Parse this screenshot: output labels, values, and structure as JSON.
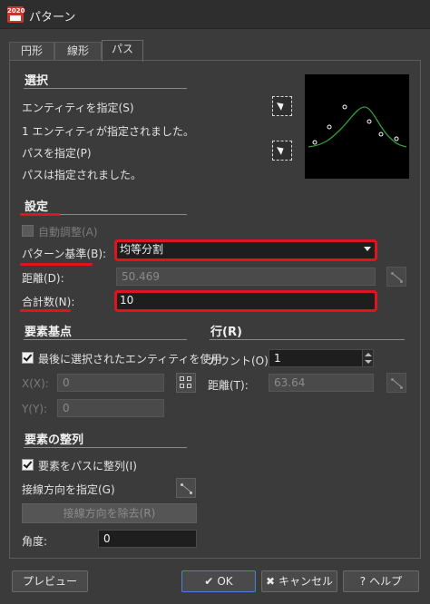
{
  "window": {
    "title": "パターン",
    "logo_text": "2020"
  },
  "tabs": [
    {
      "label": "円形",
      "active": false
    },
    {
      "label": "線形",
      "active": false
    },
    {
      "label": "パス",
      "active": true
    }
  ],
  "selection": {
    "heading": "選択",
    "entity_label": "エンティティを指定(S)",
    "entity_status": "1 エンティティが指定されました。",
    "path_label": "パスを指定(P)",
    "path_status": "パスは指定されました。"
  },
  "settings": {
    "heading": "設定",
    "auto_adjust_label": "自動調整(A)",
    "pattern_basis_label": "パターン基準(B):",
    "pattern_basis_value": "均等分割",
    "distance_label": "距離(D):",
    "distance_value": "50.469",
    "total_label": "合計数(N):",
    "total_value": "10"
  },
  "base_point": {
    "heading": "要素基点",
    "last_selected_label": "最後に選択されたエンティティを使用",
    "last_selected_checked": true,
    "x_label": "X(X):",
    "x_value": "0",
    "y_label": "Y(Y):",
    "y_value": "0"
  },
  "row": {
    "heading": "行(R)",
    "count_label": "カウント(O):",
    "count_value": "1",
    "distance_label": "距離(T):",
    "distance_value": "63.64"
  },
  "alignment": {
    "heading": "要素の整列",
    "align_label": "要素をパスに整列(I)",
    "align_checked": true,
    "tangent_label": "接線方向を指定(G)",
    "remove_tangent_label": "接線方向を除去(R)",
    "angle_label": "角度:",
    "angle_value": "0"
  },
  "buttons": {
    "preview": "プレビュー",
    "ok": "OK",
    "cancel": "キャンセル",
    "help": "ヘルプ"
  },
  "colors": {
    "highlight": "#e0141e",
    "preview_curve": "#2e9e3a",
    "ok_border": "#4f7fd4"
  }
}
